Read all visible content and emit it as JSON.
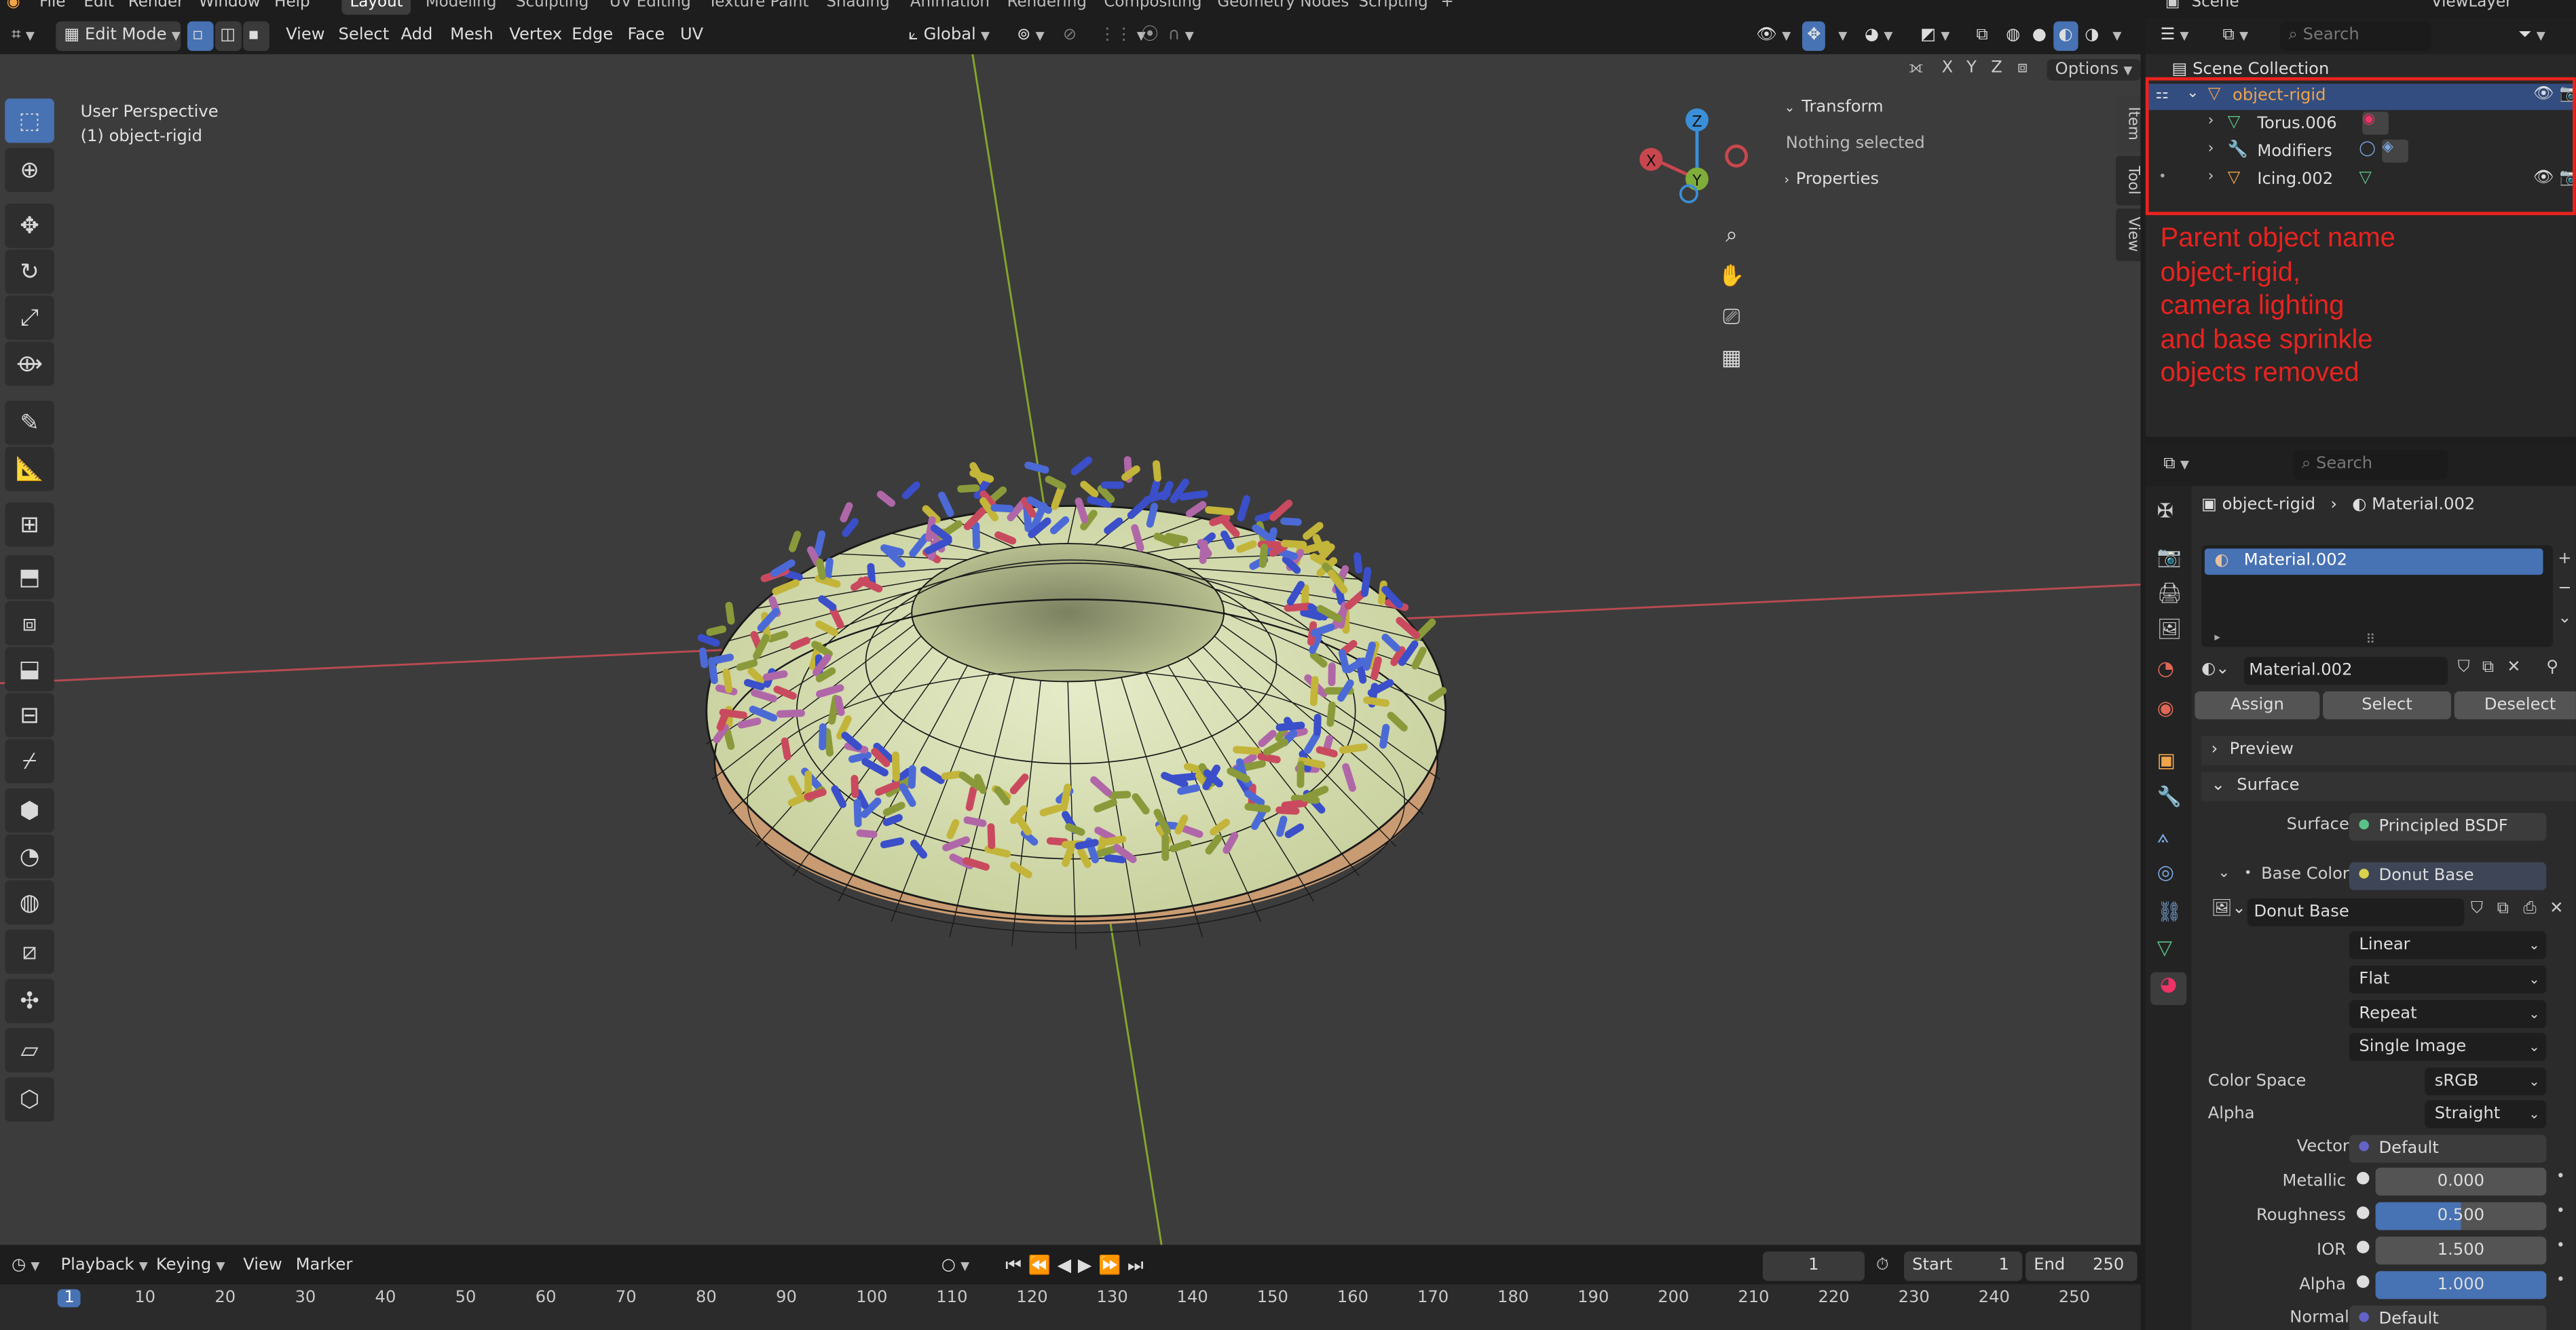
{
  "menu": [
    "File",
    "Edit",
    "Render",
    "Window",
    "Help"
  ],
  "workspaces": [
    "Layout",
    "Modeling",
    "Sculpting",
    "UV Editing",
    "Texture Paint",
    "Shading",
    "Animation",
    "Rendering",
    "Compositing",
    "Geometry Nodes",
    "Scripting"
  ],
  "active_workspace": "Layout",
  "scene_name": "Scene",
  "view_layer": "ViewLayer",
  "viewport_header": {
    "mode": "Edit Mode",
    "menus": [
      "View",
      "Select",
      "Add",
      "Mesh",
      "Vertex",
      "Edge",
      "Face",
      "UV"
    ],
    "transform_orientation": "Global",
    "options_label": "Options",
    "axes": [
      "X",
      "Y",
      "Z"
    ]
  },
  "viewport": {
    "perspective": "User Perspective",
    "object_label": "(1) object-rigid",
    "gizmo": {
      "x": "X",
      "y": "Y",
      "z": "Z"
    }
  },
  "npanel": {
    "transform_title": "Transform",
    "transform_text": "Nothing selected",
    "properties_title": "Properties",
    "tabs": [
      "Item",
      "Tool",
      "View"
    ]
  },
  "timeline": {
    "menus": [
      "Playback",
      "Keying",
      "View",
      "Marker"
    ],
    "current_frame": "1",
    "start_label": "Start",
    "start": "1",
    "end_label": "End",
    "end": "250",
    "ruler": [
      "1",
      "10",
      "20",
      "30",
      "40",
      "50",
      "60",
      "70",
      "80",
      "90",
      "100",
      "110",
      "120",
      "130",
      "140",
      "150",
      "160",
      "170",
      "180",
      "190",
      "200",
      "210",
      "220",
      "230",
      "240",
      "250"
    ]
  },
  "outliner": {
    "search_placeholder": "Search",
    "scene_collection": "Scene Collection",
    "items": [
      {
        "label": "object-rigid",
        "selected": true
      },
      {
        "label": "Torus.006"
      },
      {
        "label": "Modifiers"
      },
      {
        "label": "Icing.002"
      }
    ]
  },
  "annotation": {
    "text": "Parent object name object-rigid, camera lighting and base sprinkle objects removed",
    "lines": [
      "Parent object name",
      "object-rigid,",
      "camera lighting",
      "and base sprinkle",
      "objects removed"
    ],
    "color": "#e8231f"
  },
  "properties": {
    "search_placeholder": "Search",
    "breadcrumb_object": "object-rigid",
    "breadcrumb_material": "Material.002",
    "slot_material": "Material.002",
    "material_name": "Material.002",
    "buttons": [
      "Assign",
      "Select",
      "Deselect"
    ],
    "preview_label": "Preview",
    "surface_section": "Surface",
    "surface_label": "Surface",
    "surface_value": "Principled BSDF",
    "base_color_label": "Base Color",
    "base_color_value": "Donut Base",
    "image_name": "Donut Base",
    "image_dropdowns": [
      "Linear",
      "Flat",
      "Repeat",
      "Single Image"
    ],
    "color_space_label": "Color Space",
    "color_space_value": "sRGB",
    "alpha_mode_label": "Alpha",
    "alpha_mode_value": "Straight",
    "vector_label": "Vector",
    "vector_value": "Default",
    "metallic_label": "Metallic",
    "metallic_value": "0.000",
    "roughness_label": "Roughness",
    "roughness_value": "0.500",
    "roughness_fraction": 0.5,
    "ior_label": "IOR",
    "ior_value": "1.500",
    "alpha_label": "Alpha",
    "alpha_value": "1.000",
    "alpha_fraction": 1.0,
    "normal_label": "Normal",
    "normal_value": "Default"
  },
  "colors": {
    "accent": "#4772b3",
    "viewport_bg": "#3c3c3c",
    "x_axis": "#c8474e",
    "y_axis": "#7fad3a",
    "z_axis": "#3b8fd9",
    "icing": "#d7dfb4",
    "dough": "#c99b72"
  }
}
